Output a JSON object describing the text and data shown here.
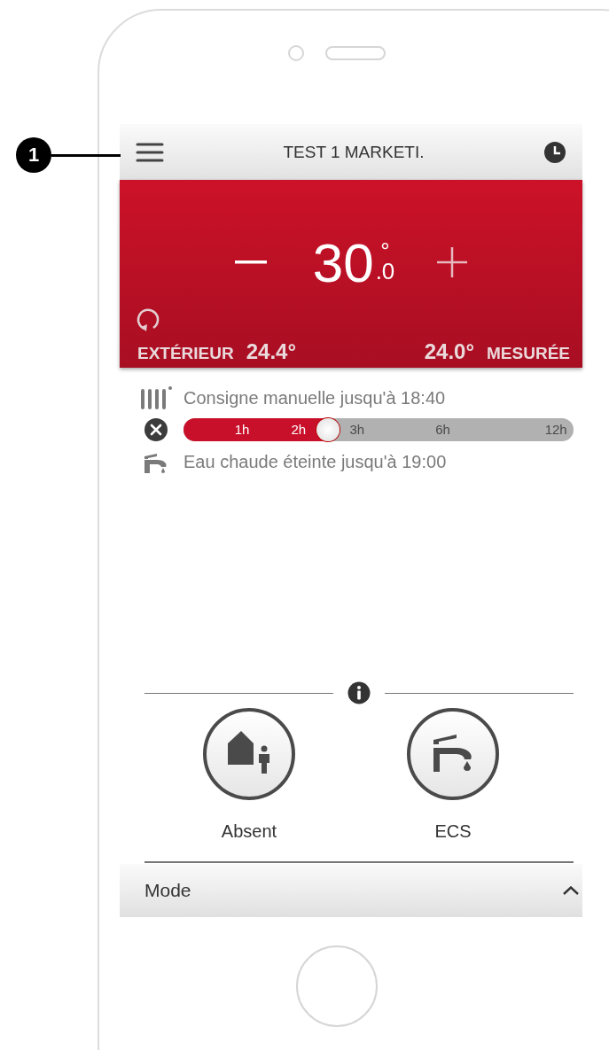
{
  "callout": {
    "number": "1"
  },
  "header": {
    "title": "TEST 1 MARKETI."
  },
  "thermostat": {
    "setpoint_whole": "30",
    "setpoint_decimal": ".0",
    "degree": "°",
    "outdoor_label": "EXTÉRIEUR",
    "outdoor_value": "24.4°",
    "measured_value": "24.0°",
    "measured_label": "MESURÉE"
  },
  "status": [
    {
      "kind": "heating",
      "text": "Consigne manuelle jusqu'à 18:40"
    },
    {
      "kind": "slider",
      "level": 0.37,
      "ticks": [
        "1h",
        "2h",
        "3h",
        "6h",
        "12h"
      ]
    },
    {
      "kind": "hotwater",
      "text": "Eau chaude éteinte jusqu'à 19:00"
    }
  ],
  "modes": [
    {
      "label": "Absent",
      "kind": "away"
    },
    {
      "label": "ECS",
      "kind": "hotwater"
    }
  ],
  "mode_bar": {
    "label": "Mode"
  }
}
